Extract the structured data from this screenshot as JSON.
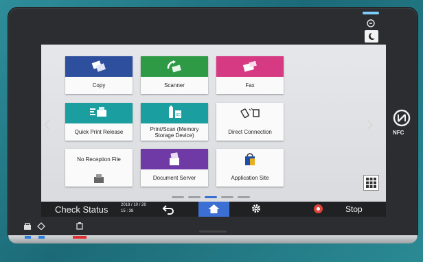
{
  "tiles": [
    {
      "label": "Copy",
      "icon": "copy-icon",
      "color": "#2e4e9e"
    },
    {
      "label": "Scanner",
      "icon": "scanner-icon",
      "color": "#2f9a45"
    },
    {
      "label": "Fax",
      "icon": "fax-icon",
      "color": "#d63a82"
    },
    {
      "label": "Quick Print Release",
      "icon": "quick-print-icon",
      "color": "#1a9ea0"
    },
    {
      "label": "Print/Scan (Memory Storage Device)",
      "icon": "memory-storage-icon",
      "color": "#1a9ea0"
    },
    {
      "label": "Direct Connection",
      "icon": "direct-connection-icon",
      "color": "#fafafa"
    },
    {
      "label": "No Reception File",
      "icon": "fax-tray-icon",
      "color": "#fafafa"
    },
    {
      "label": "Document Server",
      "icon": "document-server-icon",
      "color": "#6f3aa6"
    },
    {
      "label": "Application Site",
      "icon": "shopping-bag-icon",
      "color": "#fafafa"
    }
  ],
  "statusbar": {
    "check_status": "Check Status",
    "date": "2018 / 10 / 26",
    "time": "15 : 38",
    "stop": "Stop"
  },
  "side": {
    "nfc": "NFC"
  },
  "colors": {
    "home_active": "#3c6fd4",
    "stop_red": "#e0453a",
    "led_blue": "#2b7fe0",
    "led_red": "#e03030"
  }
}
